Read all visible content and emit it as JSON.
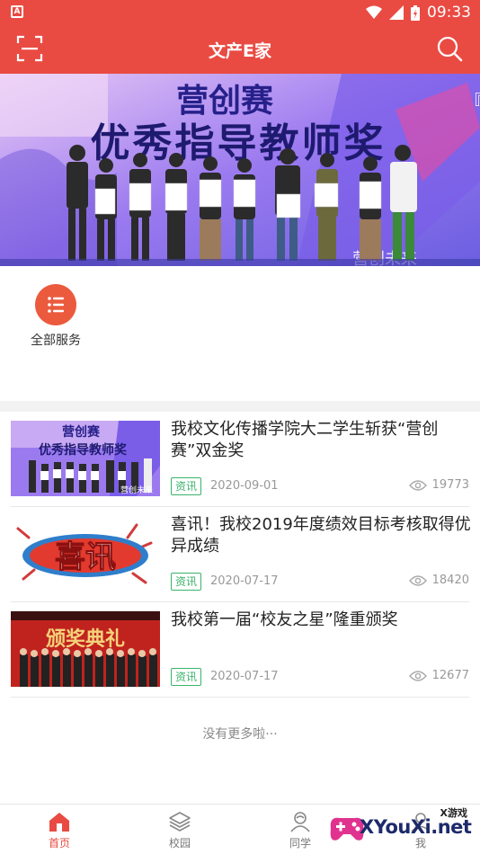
{
  "status_bar": {
    "time": "09:33",
    "app_badge": "A"
  },
  "app_bar": {
    "title": "文产E家"
  },
  "banner": {
    "headline_top": "营创赛",
    "headline_main": "优秀指导教师奖",
    "bottom_text": "营创未来",
    "side_text": "『",
    "certificate_label": "荣誉证书"
  },
  "services": [
    {
      "label": "全部服务",
      "icon": "list-icon",
      "color": "#ec5a3e"
    }
  ],
  "news": [
    {
      "title": "我校文化传播学院大二学生斩获“营创赛”双金奖",
      "tag": "资讯",
      "date": "2020-09-01",
      "views": "19773",
      "thumb": "award-ceremony",
      "thumb_text": "营创赛",
      "thumb_sub": "优秀指导教师奖",
      "thumb_bottom": "营创未来"
    },
    {
      "title": "喜讯！我校2019年度绩效目标考核取得优异成绩",
      "tag": "资讯",
      "date": "2020-07-17",
      "views": "18420",
      "thumb": "good-news-banner",
      "thumb_text": "喜讯"
    },
    {
      "title": "我校第一届“校友之星”隆重颁奖",
      "tag": "资讯",
      "date": "2020-07-17",
      "views": "12677",
      "thumb": "alumni-award",
      "thumb_text": "颁奖典礼"
    }
  ],
  "list_footer": "没有更多啦···",
  "bottom_nav": [
    {
      "label": "首页",
      "icon": "home-icon",
      "active": true
    },
    {
      "label": "校园",
      "icon": "layers-icon",
      "active": false
    },
    {
      "label": "同学",
      "icon": "classmates-icon",
      "active": false
    },
    {
      "label": "我",
      "icon": "profile-icon",
      "active": false
    }
  ],
  "watermark": {
    "small": "X游戏",
    "big": "XYouXi.net"
  },
  "colors": {
    "primary": "#e94b43",
    "tag": "#3ab36a",
    "service": "#ec5a3e"
  }
}
